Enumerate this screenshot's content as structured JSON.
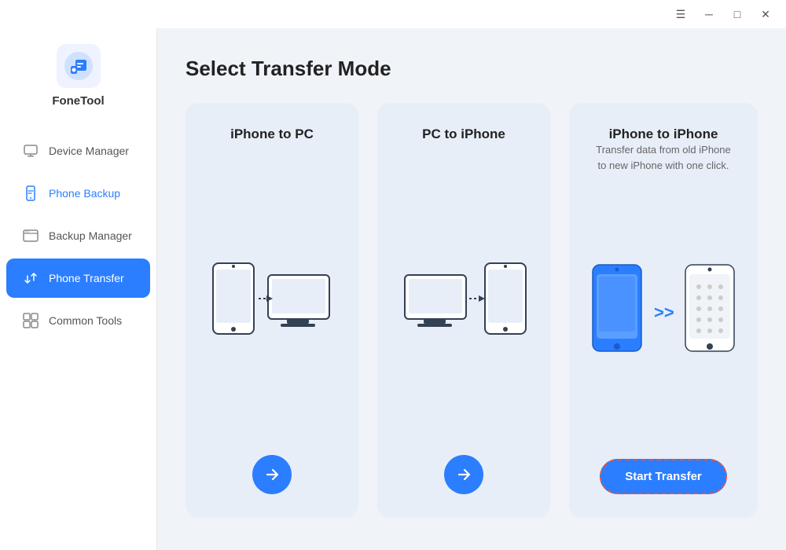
{
  "titleBar": {
    "menu_icon": "☰",
    "minimize_icon": "—",
    "maximize_icon": "□",
    "close_icon": "✕"
  },
  "sidebar": {
    "logo_text": "FoneTool",
    "nav_items": [
      {
        "id": "device-manager",
        "label": "Device Manager",
        "active": false
      },
      {
        "id": "phone-backup",
        "label": "Phone Backup",
        "active": false
      },
      {
        "id": "backup-manager",
        "label": "Backup Manager",
        "active": false
      },
      {
        "id": "phone-transfer",
        "label": "Phone Transfer",
        "active": true
      },
      {
        "id": "common-tools",
        "label": "Common Tools",
        "active": false
      }
    ]
  },
  "main": {
    "page_title": "Select Transfer Mode",
    "cards": [
      {
        "id": "iphone-to-pc",
        "title": "iPhone to PC",
        "description": "",
        "has_arrow": true,
        "has_start_btn": false
      },
      {
        "id": "pc-to-iphone",
        "title": "PC to iPhone",
        "description": "",
        "has_arrow": true,
        "has_start_btn": false
      },
      {
        "id": "iphone-to-iphone",
        "title": "iPhone to iPhone",
        "description": "Transfer data from old iPhone to new iPhone with one click.",
        "has_arrow": false,
        "has_start_btn": true,
        "start_btn_label": "Start Transfer"
      }
    ]
  }
}
